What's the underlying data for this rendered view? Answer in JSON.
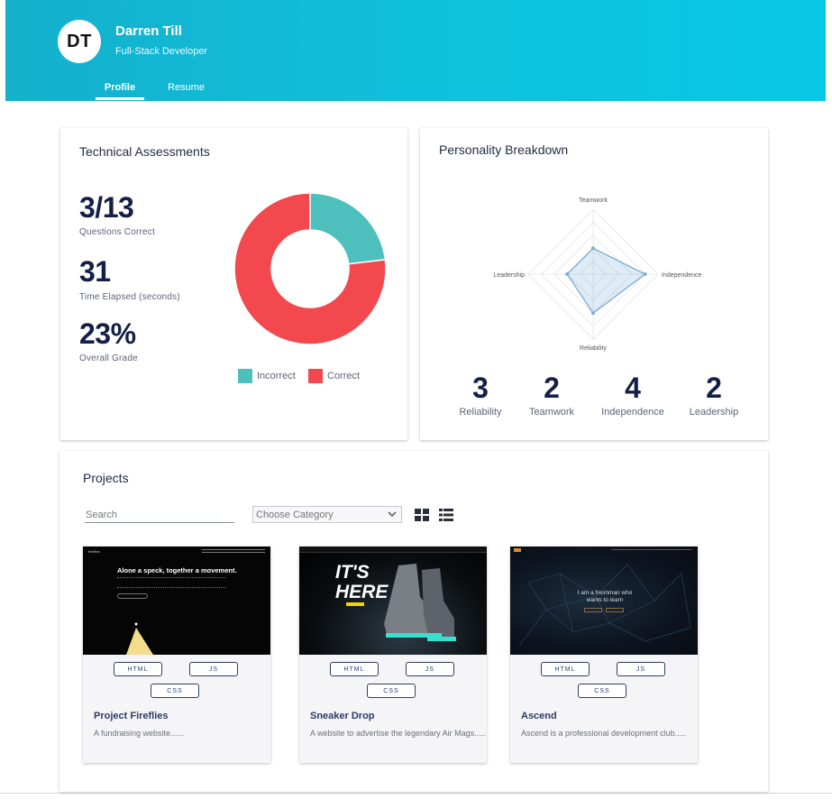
{
  "header": {
    "avatar_initials": "DT",
    "name": "Darren Till",
    "role": "Full-Stack Developer",
    "tabs": [
      {
        "label": "Profile",
        "active": true
      },
      {
        "label": "Resume",
        "active": false
      }
    ]
  },
  "technical": {
    "title": "Technical Assessments",
    "stats": [
      {
        "value": "3/13",
        "label": "Questions Correct"
      },
      {
        "value": "31",
        "label": "Time Elapsed (seconds)"
      },
      {
        "value": "23%",
        "label": "Overall Grade"
      }
    ],
    "chart_data": {
      "type": "pie",
      "categories": [
        "Incorrect",
        "Correct"
      ],
      "values": [
        3,
        10
      ],
      "colors": [
        "#4dbfbd",
        "#f3484d"
      ],
      "legend": "bottom"
    }
  },
  "personality": {
    "title": "Personality Breakdown",
    "chart_data": {
      "type": "radar",
      "axes": [
        "Teamwork",
        "Independence",
        "Reliability",
        "Leadership"
      ],
      "values": [
        2,
        4,
        3,
        2
      ],
      "max": 5,
      "color": "#7fb0d8"
    },
    "scores": [
      {
        "value": "3",
        "label": "Reliability"
      },
      {
        "value": "2",
        "label": "Teamwork"
      },
      {
        "value": "4",
        "label": "Independence"
      },
      {
        "value": "2",
        "label": "Leadership"
      }
    ]
  },
  "projects": {
    "title": "Projects",
    "search_placeholder": "Search",
    "category_placeholder": "Choose Category",
    "icons": {
      "grid": "grid-view-icon",
      "list": "list-view-icon",
      "dropdown": "chevron-down-icon"
    },
    "items": [
      {
        "title": "Project Fireflies",
        "description": "A fundraising website......",
        "tags": [
          "HTML",
          "JS",
          "CSS"
        ],
        "thumb_text": "Alone a speck, together a movement.",
        "thumb_brand": "fireflies"
      },
      {
        "title": "Sneaker Drop",
        "description": "A website to advertise the legendary Air Mags.....",
        "tags": [
          "HTML",
          "JS",
          "CSS"
        ],
        "thumb_text": "IT'S HERE"
      },
      {
        "title": "Ascend",
        "description": "Ascend is a professional development club.....",
        "tags": [
          "HTML",
          "JS",
          "CSS"
        ],
        "thumb_text": "I am a freshman who wants to learn"
      }
    ]
  }
}
